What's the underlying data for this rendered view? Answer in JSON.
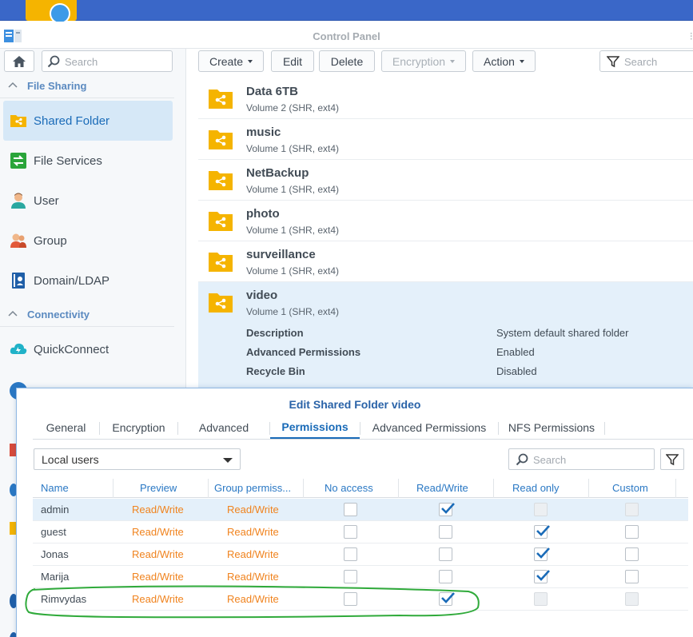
{
  "window": {
    "title": "Control Panel"
  },
  "sidebar": {
    "search_placeholder": "Search",
    "sections": [
      {
        "label": "File Sharing"
      },
      {
        "label": "Connectivity"
      }
    ],
    "items": [
      {
        "label": "Shared Folder",
        "icon": "shared-folder-icon"
      },
      {
        "label": "File Services",
        "icon": "file-services-icon"
      },
      {
        "label": "User",
        "icon": "user-icon"
      },
      {
        "label": "Group",
        "icon": "group-icon"
      },
      {
        "label": "Domain/LDAP",
        "icon": "domain-ldap-icon"
      },
      {
        "label": "QuickConnect",
        "icon": "quickconnect-icon"
      }
    ]
  },
  "toolbar": {
    "create": "Create",
    "edit": "Edit",
    "delete": "Delete",
    "encryption": "Encryption",
    "action": "Action",
    "search_placeholder": "Search"
  },
  "folders": [
    {
      "name": "Data 6TB",
      "volume": "Volume 2 (SHR, ext4)"
    },
    {
      "name": "music",
      "volume": "Volume 1 (SHR, ext4)"
    },
    {
      "name": "NetBackup",
      "volume": "Volume 1 (SHR, ext4)"
    },
    {
      "name": "photo",
      "volume": "Volume 1 (SHR, ext4)"
    },
    {
      "name": "surveillance",
      "volume": "Volume 1 (SHR, ext4)"
    },
    {
      "name": "video",
      "volume": "Volume 1 (SHR, ext4)"
    }
  ],
  "selected_folder_props": [
    {
      "label": "Description",
      "value": "System default shared folder"
    },
    {
      "label": "Advanced Permissions",
      "value": "Enabled"
    },
    {
      "label": "Recycle Bin",
      "value": "Disabled"
    }
  ],
  "dialog": {
    "title": "Edit Shared Folder video",
    "tabs": [
      "General",
      "Encryption",
      "Advanced",
      "Permissions",
      "Advanced Permissions",
      "NFS Permissions"
    ],
    "active_tab": "Permissions",
    "user_scope": "Local users",
    "search_placeholder": "Search",
    "columns": [
      "Name",
      "Preview",
      "Group permiss...",
      "No access",
      "Read/Write",
      "Read only",
      "Custom"
    ],
    "rows": [
      {
        "name": "admin",
        "preview": "Read/Write",
        "group": "Read/Write",
        "no_access": false,
        "read_write": true,
        "read_only": false,
        "custom": false,
        "ro_disabled": true,
        "custom_disabled": true
      },
      {
        "name": "guest",
        "preview": "Read/Write",
        "group": "Read/Write",
        "no_access": false,
        "read_write": false,
        "read_only": true,
        "custom": false,
        "ro_disabled": false,
        "custom_disabled": false
      },
      {
        "name": "Jonas",
        "preview": "Read/Write",
        "group": "Read/Write",
        "no_access": false,
        "read_write": false,
        "read_only": true,
        "custom": false,
        "ro_disabled": false,
        "custom_disabled": false
      },
      {
        "name": "Marija",
        "preview": "Read/Write",
        "group": "Read/Write",
        "no_access": false,
        "read_write": false,
        "read_only": true,
        "custom": false,
        "ro_disabled": false,
        "custom_disabled": false
      },
      {
        "name": "Rimvydas",
        "preview": "Read/Write",
        "group": "Read/Write",
        "no_access": false,
        "read_write": true,
        "read_only": false,
        "custom": false,
        "ro_disabled": true,
        "custom_disabled": true
      }
    ]
  },
  "colors": {
    "accent": "#1a6bb8",
    "permission_text": "#f0831e",
    "folder_icon": "#f5b400",
    "annotation": "#2faa3a"
  }
}
